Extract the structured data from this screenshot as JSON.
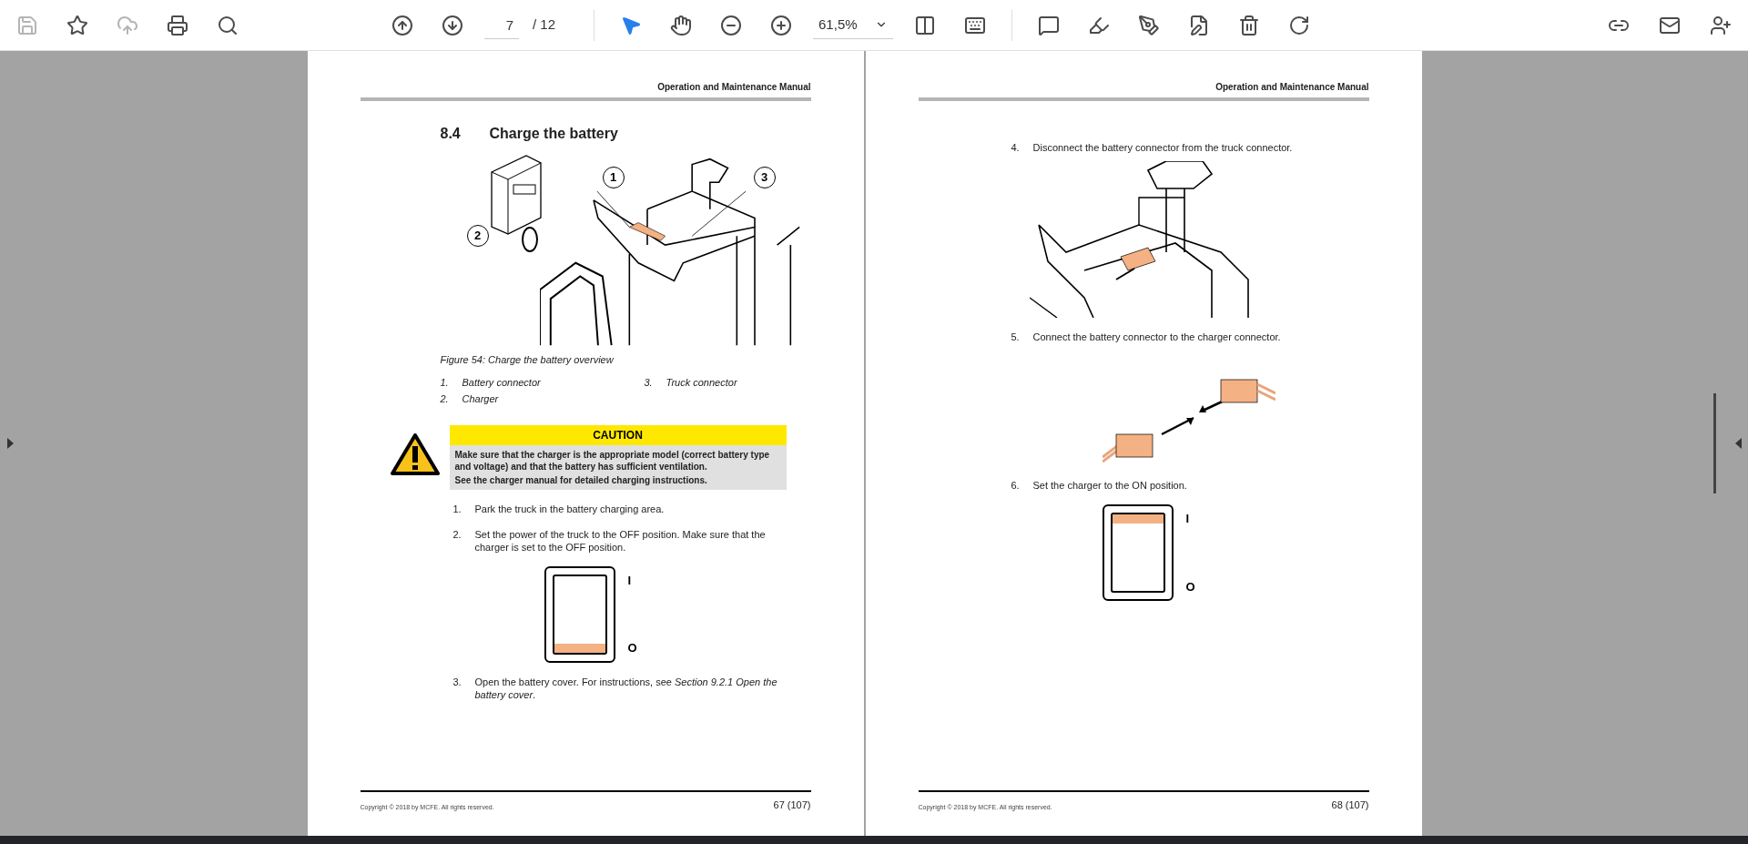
{
  "toolbar": {
    "page_field": {
      "value": "7"
    },
    "page_total": "/ 12",
    "zoom_field": {
      "value": "61,5%"
    }
  },
  "pages": [
    {
      "header": "Operation and Maintenance Manual",
      "footer_copyright": "Copyright © 2018 by MCFE. All rights reserved.",
      "page_number": "67 (107)",
      "blocks": [
        {
          "kind": "heading",
          "number": "8.4",
          "text": "Charge the battery"
        },
        {
          "kind": "overview_figure",
          "callouts": [
            "1",
            "2",
            "3"
          ]
        },
        {
          "kind": "caption",
          "text": "Figure 54: Charge the battery overview"
        },
        {
          "kind": "legend",
          "items": [
            {
              "number": "1.",
              "text": "Battery connector"
            },
            {
              "number": "3.",
              "text": "Truck connector"
            },
            {
              "number": "2.",
              "text": "Charger"
            }
          ]
        },
        {
          "kind": "caution",
          "title": "CAUTION",
          "lines": [
            "Make sure that the charger is the appropriate model (correct battery type and voltage) and that the battery has sufficient ventilation.",
            "See the charger manual for detailed charging instructions."
          ]
        },
        {
          "kind": "step",
          "number": "1.",
          "text": "Park the truck in the battery charging area."
        },
        {
          "kind": "step",
          "number": "2.",
          "text": "Set the power of the truck to the OFF position. Make sure that the charger is set to the OFF position."
        },
        {
          "kind": "switch",
          "on": false,
          "on_label": "I",
          "off_label": "O"
        },
        {
          "kind": "step",
          "number": "3.",
          "text": "Open the battery cover. For instructions, see *Section 9.2.1 Open the battery cover*."
        }
      ]
    },
    {
      "header": "Operation and Maintenance Manual",
      "footer_copyright": "Copyright © 2018 by MCFE. All rights reserved.",
      "page_number": "68 (107)",
      "blocks": [
        {
          "kind": "step",
          "number": "4.",
          "text": "Disconnect the battery connector from the truck connector."
        },
        {
          "kind": "truck_figure"
        },
        {
          "kind": "step",
          "number": "5.",
          "text": "Connect the battery connector to the charger connector."
        },
        {
          "kind": "connector_figure"
        },
        {
          "kind": "step",
          "number": "6.",
          "text": "Set the charger to the ON position."
        },
        {
          "kind": "switch",
          "on": true,
          "on_label": "I",
          "off_label": "O"
        }
      ]
    }
  ]
}
